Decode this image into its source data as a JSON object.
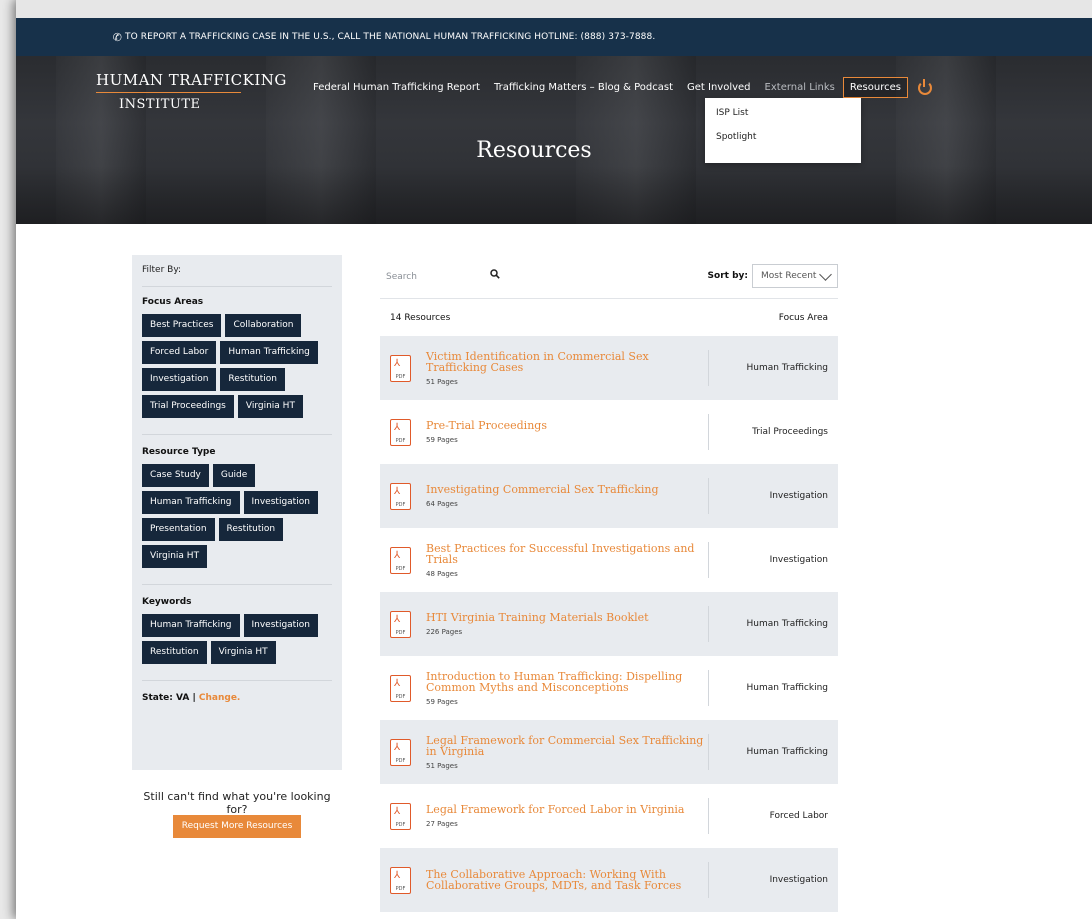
{
  "topbar": {
    "phone_icon": "phone-icon",
    "hotline_text": "TO REPORT A TRAFFICKING CASE IN THE U.S., CALL THE NATIONAL HUMAN TRAFFICKING HOTLINE: (888) 373-7888."
  },
  "logo": {
    "line1": "Human Trafficking",
    "line2": "Institute"
  },
  "nav": {
    "items": [
      "Federal Human Trafficking Report",
      "Trafficking Matters – Blog & Podcast",
      "Get Involved",
      "External Links",
      "Resources"
    ],
    "power_icon": "power-icon"
  },
  "dropdown": {
    "items": [
      "ISP List",
      "Spotlight"
    ]
  },
  "hero": {
    "title": "Resources"
  },
  "sidebar": {
    "filter_by": "Filter By:",
    "focus_areas": {
      "heading": "Focus Areas",
      "chips": [
        "Best Practices",
        "Collaboration",
        "Forced Labor",
        "Human Trafficking",
        "Investigation",
        "Restitution",
        "Trial Proceedings",
        "Virginia HT"
      ]
    },
    "resource_type": {
      "heading": "Resource Type",
      "chips": [
        "Case Study",
        "Guide",
        "Human Trafficking",
        "Investigation",
        "Presentation",
        "Restitution",
        "Virginia HT"
      ]
    },
    "keywords": {
      "heading": "Keywords",
      "chips": [
        "Human Trafficking",
        "Investigation",
        "Restitution",
        "Virginia HT"
      ]
    },
    "state_label": "State: VA |",
    "state_change": "Change."
  },
  "help": {
    "text": "Still can't find what you're looking for?",
    "button": "Request More Resources"
  },
  "search": {
    "placeholder": "Search",
    "icon": "search-icon"
  },
  "sort": {
    "label": "Sort by:",
    "value": "Most Recent"
  },
  "list": {
    "count": "14 Resources",
    "focus_header": "Focus Area",
    "pdf_label": "PDF",
    "items": [
      {
        "title": "Victim Identification in Commercial Sex Trafficking Cases",
        "pages": "51 Pages",
        "focus": "Human Trafficking"
      },
      {
        "title": "Pre-Trial Proceedings",
        "pages": "59 Pages",
        "focus": "Trial Proceedings"
      },
      {
        "title": "Investigating Commercial Sex Trafficking",
        "pages": "64 Pages",
        "focus": "Investigation"
      },
      {
        "title": "Best Practices for Successful Investigations and Trials",
        "pages": "48 Pages",
        "focus": "Investigation"
      },
      {
        "title": "HTI Virginia Training Materials Booklet",
        "pages": "226 Pages",
        "focus": "Human Trafficking"
      },
      {
        "title": "Introduction to Human Trafficking: Dispelling Common Myths and Misconceptions",
        "pages": "59 Pages",
        "focus": "Human Trafficking"
      },
      {
        "title": "Legal Framework for Commercial Sex Trafficking in Virginia",
        "pages": "51 Pages",
        "focus": "Human Trafficking"
      },
      {
        "title": "Legal Framework for Forced Labor in Virginia",
        "pages": "27 Pages",
        "focus": "Forced Labor"
      },
      {
        "title": "The Collaborative Approach: Working With Collaborative Groups, MDTs, and Task Forces",
        "pages": "",
        "focus": "Investigation"
      }
    ]
  },
  "colors": {
    "navy": "#17314a",
    "accent": "#e8893a",
    "chip": "#16273b",
    "panel": "#e8ebef"
  }
}
